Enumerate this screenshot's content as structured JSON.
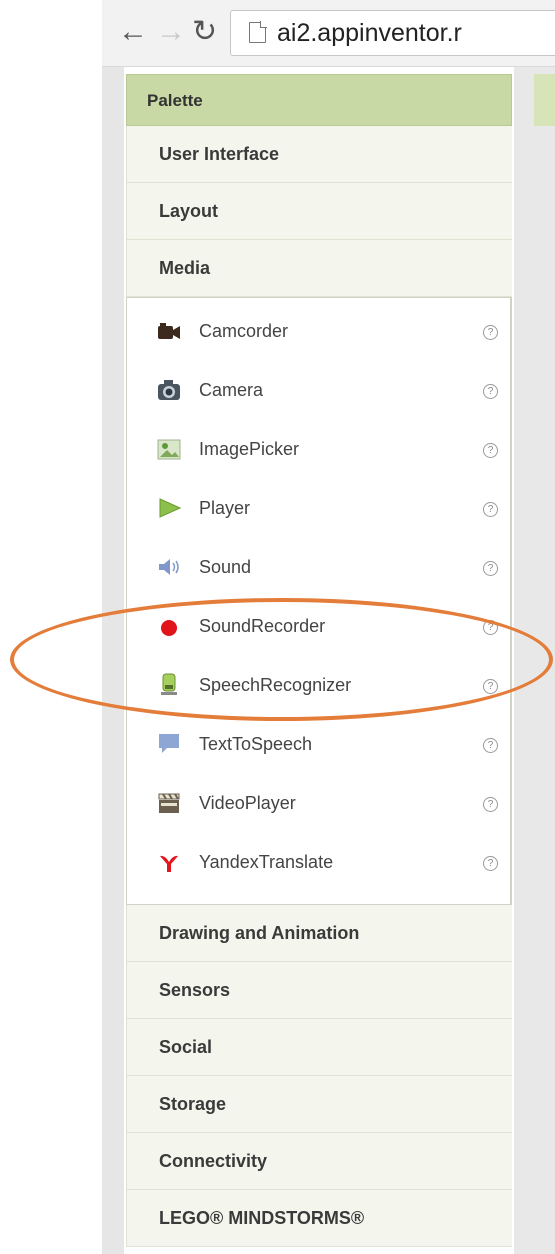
{
  "browser": {
    "url": "ai2.appinventor.r"
  },
  "palette": {
    "title": "Palette",
    "categories_top": [
      "User Interface",
      "Layout",
      "Media"
    ],
    "components": [
      {
        "label": "Camcorder",
        "icon": "camcorder-icon"
      },
      {
        "label": "Camera",
        "icon": "camera-icon"
      },
      {
        "label": "ImagePicker",
        "icon": "image-picker-icon"
      },
      {
        "label": "Player",
        "icon": "player-icon"
      },
      {
        "label": "Sound",
        "icon": "sound-icon"
      },
      {
        "label": "SoundRecorder",
        "icon": "record-icon"
      },
      {
        "label": "SpeechRecognizer",
        "icon": "microphone-icon"
      },
      {
        "label": "TextToSpeech",
        "icon": "speech-bubble-icon"
      },
      {
        "label": "VideoPlayer",
        "icon": "clapperboard-icon"
      },
      {
        "label": "YandexTranslate",
        "icon": "yandex-icon"
      }
    ],
    "help_glyph": "?",
    "categories_bottom": [
      "Drawing and Animation",
      "Sensors",
      "Social",
      "Storage",
      "Connectivity",
      "LEGO® MINDSTORMS®"
    ]
  },
  "colors": {
    "highlight_ellipse": "#e47c3a",
    "palette_header": "#c9d9a6"
  }
}
